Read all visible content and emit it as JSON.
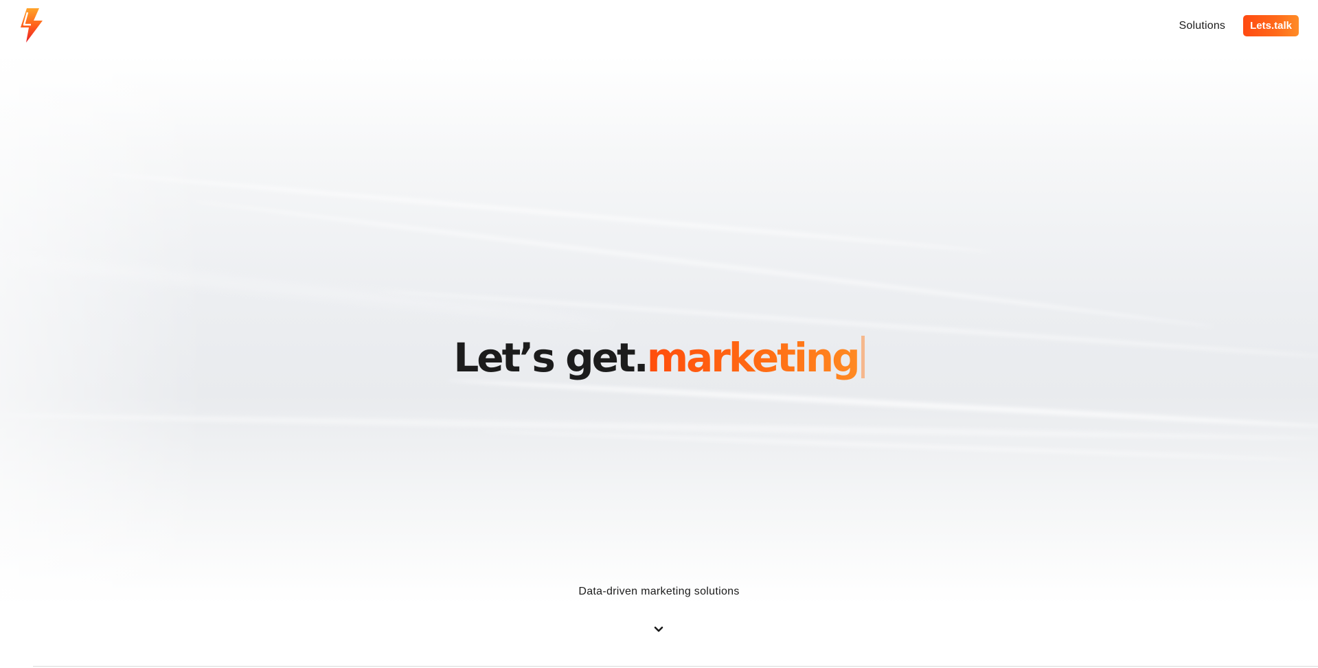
{
  "brand": {
    "logo_icon": "lightning-bolt-icon",
    "accent_start": "#ff4a12",
    "accent_end": "#ff8c26"
  },
  "nav": {
    "solutions_label": "Solutions",
    "cta_label": "Lets.talk"
  },
  "hero": {
    "headline_lead": "Let’s get.",
    "headline_rotating_word": "marketing",
    "tagline": "Data-driven marketing solutions",
    "scroll_icon": "chevron-down-icon"
  }
}
